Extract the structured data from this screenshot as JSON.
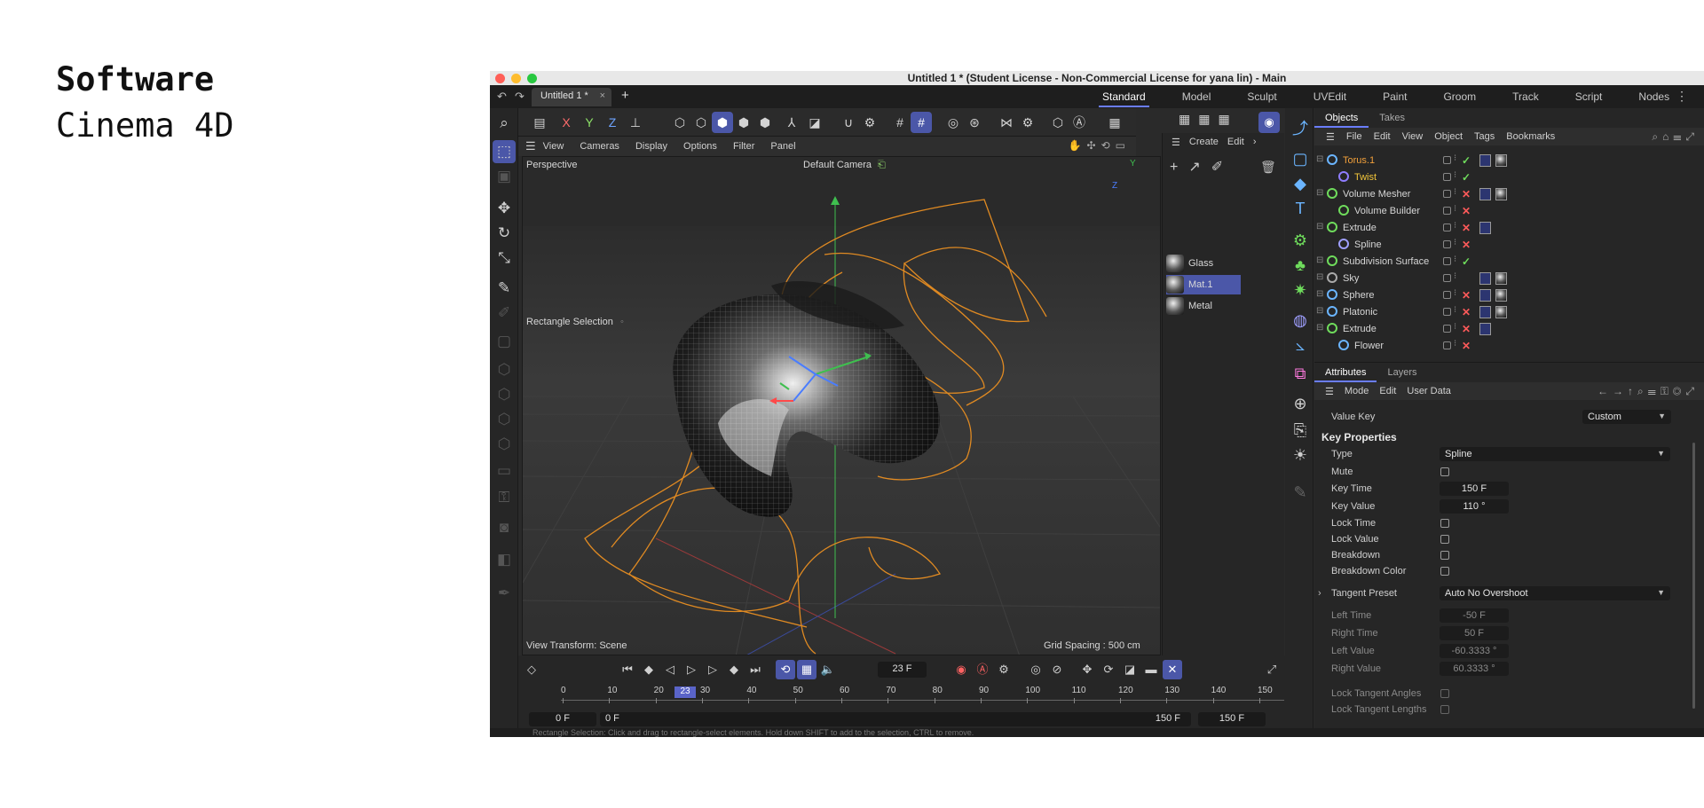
{
  "slide": {
    "heading": "Software",
    "subheading": "Cinema 4D"
  },
  "window": {
    "title": "Untitled 1 * (Student License - Non-Commercial License for yana lin) - Main"
  },
  "tabs": {
    "document": "Untitled 1 *",
    "close": "×",
    "new": "+"
  },
  "layouts": [
    "Standard",
    "Model",
    "Sculpt",
    "UVEdit",
    "Paint",
    "Groom",
    "Track",
    "Script",
    "Nodes"
  ],
  "axes": {
    "x": "X",
    "y": "Y",
    "z": "Z"
  },
  "viewport_menu": [
    "View",
    "Cameras",
    "Display",
    "Options",
    "Filter",
    "Panel"
  ],
  "viewport": {
    "projection": "Perspective",
    "camera": "Default Camera",
    "tool_hint": "Rectangle Selection",
    "view_transform": "View Transform: Scene",
    "grid_spacing": "Grid Spacing : 500 cm",
    "gizmo_y": "Y",
    "gizmo_z": "Z"
  },
  "material_menu": [
    "Create",
    "Edit",
    "›"
  ],
  "materials": [
    {
      "name": "Glass",
      "selected": false
    },
    {
      "name": "Mat.1",
      "selected": true
    },
    {
      "name": "Metal",
      "selected": false
    }
  ],
  "objects_tabs": [
    "Objects",
    "Takes"
  ],
  "objects_menu": [
    "File",
    "Edit",
    "View",
    "Object",
    "Tags",
    "Bookmarks"
  ],
  "objects": [
    {
      "name": "Torus.1",
      "indent": 0,
      "color": "#f2a03a",
      "icon": "#6bb5ff",
      "status": "✓",
      "status_color": "#6fdc5c",
      "tags": 2
    },
    {
      "name": "Twist",
      "indent": 1,
      "color": "#f2c53a",
      "icon": "#8f7dff",
      "status": "✓",
      "status_color": "#6fdc5c",
      "tags": 0
    },
    {
      "name": "Volume Mesher",
      "indent": 0,
      "color": "#d6d6d6",
      "icon": "#6fdc5c",
      "status": "✕",
      "status_color": "#ff5a5a",
      "tags": 2
    },
    {
      "name": "Volume Builder",
      "indent": 1,
      "color": "#d6d6d6",
      "icon": "#6fdc5c",
      "status": "✕",
      "status_color": "#ff5a5a",
      "tags": 0
    },
    {
      "name": "Extrude",
      "indent": 0,
      "color": "#d6d6d6",
      "icon": "#6fdc5c",
      "status": "✕",
      "status_color": "#ff5a5a",
      "tags": 1
    },
    {
      "name": "Spline",
      "indent": 1,
      "color": "#d6d6d6",
      "icon": "#9f9fff",
      "status": "✕",
      "status_color": "#ff5a5a",
      "tags": 0
    },
    {
      "name": "Subdivision Surface",
      "indent": 0,
      "color": "#d6d6d6",
      "icon": "#6fdc5c",
      "status": "✓",
      "status_color": "#6fdc5c",
      "tags": 0
    },
    {
      "name": "Sky",
      "indent": 0,
      "color": "#d6d6d6",
      "icon": "#aaaaaa",
      "status": "",
      "status_color": "#6fdc5c",
      "tags": 2
    },
    {
      "name": "Sphere",
      "indent": 0,
      "color": "#d6d6d6",
      "icon": "#6bb5ff",
      "status": "✕",
      "status_color": "#ff5a5a",
      "tags": 2
    },
    {
      "name": "Platonic",
      "indent": 0,
      "color": "#d6d6d6",
      "icon": "#6bb5ff",
      "status": "✕",
      "status_color": "#ff5a5a",
      "tags": 2
    },
    {
      "name": "Extrude",
      "indent": 0,
      "color": "#d6d6d6",
      "icon": "#6fdc5c",
      "status": "✕",
      "status_color": "#ff5a5a",
      "tags": 1
    },
    {
      "name": "Flower",
      "indent": 1,
      "color": "#d6d6d6",
      "icon": "#6bb5ff",
      "status": "✕",
      "status_color": "#ff5a5a",
      "tags": 0
    }
  ],
  "attributes_tabs": [
    "Attributes",
    "Layers"
  ],
  "attributes_menu": [
    "Mode",
    "Edit",
    "User Data"
  ],
  "value_key": {
    "label": "Value Key",
    "value": "Custom"
  },
  "key_properties": {
    "title": "Key Properties",
    "type_label": "Type",
    "type_value": "Spline",
    "mute": "Mute",
    "key_time_label": "Key Time",
    "key_time": "150 F",
    "key_value_label": "Key Value",
    "key_value": "110 °",
    "lock_time": "Lock Time",
    "lock_value": "Lock Value",
    "breakdown": "Breakdown",
    "breakdown_color": "Breakdown Color",
    "tangent_preset_label": "Tangent Preset",
    "tangent_preset": "Auto No Overshoot",
    "left_time_label": "Left  Time",
    "left_time": "-50 F",
    "right_time_label": "Right Time",
    "right_time": "50 F",
    "left_value_label": "Left  Value",
    "left_value": "-60.3333 °",
    "right_value_label": "Right Value",
    "right_value": "60.3333 °",
    "lock_tangent_angles": "Lock Tangent Angles",
    "lock_tangent_lengths": "Lock Tangent Lengths"
  },
  "timeline": {
    "current_frame": "23 F",
    "ticks": [
      "0",
      "10",
      "20",
      "30",
      "40",
      "50",
      "60",
      "70",
      "80",
      "90",
      "100",
      "110",
      "120",
      "130",
      "140",
      "150"
    ],
    "cursor": "23",
    "range_start": "0 F",
    "range_min": "0 F",
    "range_max": "150 F",
    "range_end": "150 F"
  },
  "status": "Rectangle Selection: Click and drag to rectangle-select elements. Hold down SHIFT to add to the selection, CTRL to remove."
}
